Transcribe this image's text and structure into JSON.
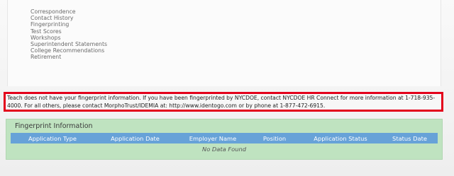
{
  "left_nav": {
    "items": [
      "Correspondence",
      "Contact History",
      "Fingerprinting",
      "Test Scores",
      "Workshops",
      "Superintendent Statements",
      "College Recommendations",
      "Retirement"
    ]
  },
  "notice": {
    "text": "Teach does not have your fingerprint information. If you have been fingerprinted by NYCDOE, contact NYCDOE HR Connect for more information at 1-718-935-4000. For all others, please contact MorphoTrust/IDEMIA at: http://www.identogo.com or by phone at 1-877-472-6915."
  },
  "fingerprint_section": {
    "title": "Fingerprint Information",
    "columns": [
      "Application Type",
      "Application Date",
      "Employer Name",
      "Position",
      "Application Status",
      "Status Date"
    ],
    "empty_message": "No Data Found"
  },
  "colors": {
    "highlight_border": "#e3001b",
    "section_background": "#bfe3c0",
    "table_header_background": "#67a2d8"
  }
}
